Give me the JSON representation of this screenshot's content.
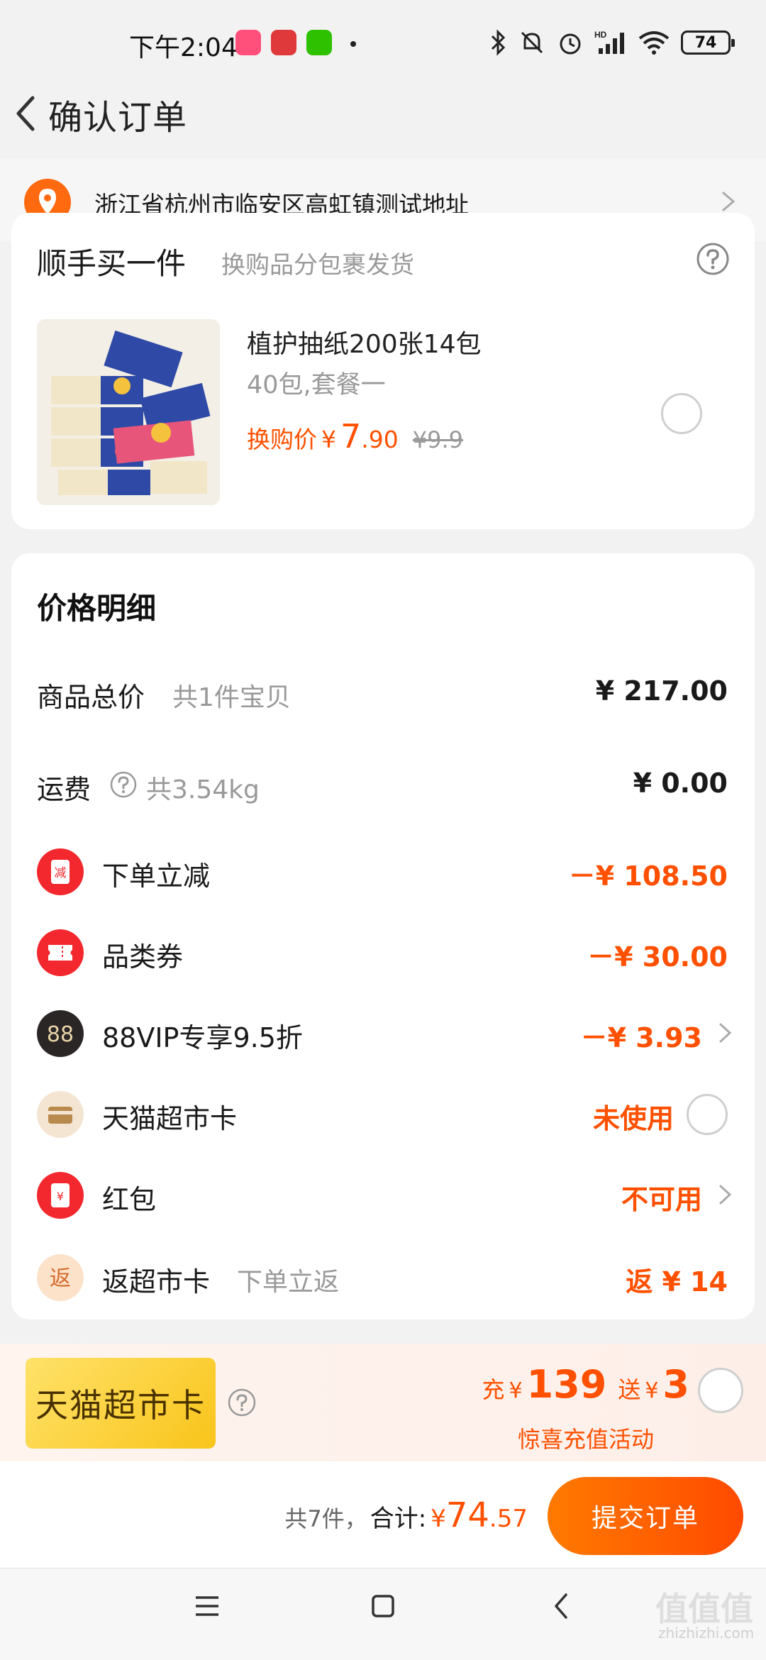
{
  "status_bar": {
    "time": "下午2:04",
    "battery": "74"
  },
  "header": {
    "title": "确认订单"
  },
  "address": {
    "text": "浙江省杭州市临安区高虹镇测试地址"
  },
  "addon_section": {
    "title": "顺手买一件",
    "subtitle": "换购品分包裹发货",
    "product": {
      "name": "植护抽纸200张14包",
      "spec": "40包,套餐一",
      "price_label": "换购价",
      "currency": "¥",
      "price_int": "7",
      "price_dec": ".90",
      "original_price": "¥9.9"
    }
  },
  "price_detail": {
    "title": "价格明细",
    "rows": [
      {
        "label": "商品总价",
        "sub": "共1件宝贝",
        "value": "¥ 217.00"
      },
      {
        "label": "运费",
        "sub": "共3.54kg",
        "value": "¥ 0.00"
      },
      {
        "label": "下单立减",
        "sub": "",
        "value": "－¥ 108.50",
        "icon": "减"
      },
      {
        "label": "品类券",
        "sub": "",
        "value": "－¥ 30.00"
      },
      {
        "label": "88VIP专享9.5折",
        "sub": "",
        "value": "－¥ 3.93",
        "icon": "88"
      },
      {
        "label": "天猫超市卡",
        "sub": "",
        "value": "未使用"
      },
      {
        "label": "红包",
        "sub": "",
        "value": "不可用",
        "icon": "¥"
      },
      {
        "label": "返超市卡",
        "sub": "下单立返",
        "value": "返 ¥ 14",
        "icon": "返"
      }
    ]
  },
  "promo": {
    "card_text": "天猫超市卡",
    "recharge_label": "充",
    "recharge_currency": "¥",
    "recharge_amount": "139",
    "gift_label": "送",
    "gift_currency": "¥",
    "gift_amount": "3",
    "note": "惊喜充值活动"
  },
  "submit_bar": {
    "count": "共7件，",
    "total_label": "合计:",
    "currency": "¥",
    "total_int": "74",
    "total_dec": ".57",
    "button": "提交订单"
  },
  "watermark": {
    "text": "值值值",
    "sub": "zhizhizhi.com"
  },
  "colors": {
    "accent": "#ff5000",
    "address_pin": "#ff6a10",
    "submit_start": "#ff7a00",
    "submit_end": "#ff4a00",
    "promo_card": "#f9c41a"
  }
}
